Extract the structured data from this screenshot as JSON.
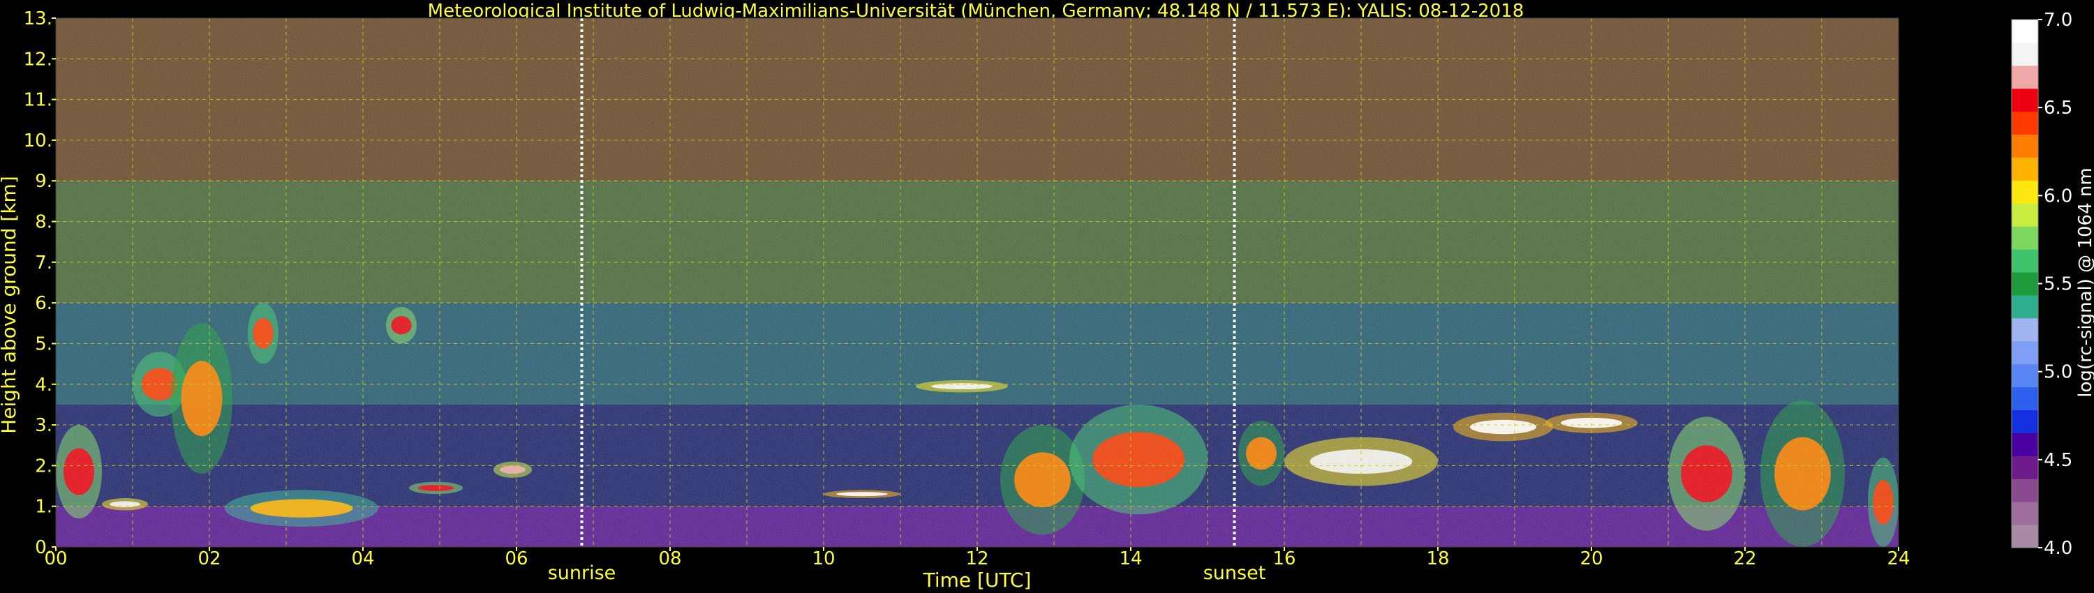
{
  "chart_data": {
    "type": "heatmap",
    "title": "Meteorological Institute of Ludwig-Maximilians-Universität (München, Germany; 48.148 N / 11.573 E):    YALIS: 08-12-2018",
    "xlabel": "Time [UTC]",
    "ylabel": "Height above ground [km]",
    "xlim": [
      0,
      24
    ],
    "ylim": [
      0,
      13
    ],
    "x_ticks": [
      "00",
      "02",
      "04",
      "06",
      "08",
      "10",
      "12",
      "14",
      "16",
      "18",
      "20",
      "22",
      "24"
    ],
    "y_ticks": [
      "0.",
      "1.",
      "2.",
      "3.",
      "4.",
      "5.",
      "6.",
      "7.",
      "8.",
      "9.",
      "10.",
      "11.",
      "12.",
      "13."
    ],
    "grid": true,
    "grid_style": "dashed yellow",
    "colorbar": {
      "label": "log(rc-signal) @ 1064 nm",
      "range": [
        4.0,
        7.0
      ],
      "ticks": [
        "4.0",
        "4.5",
        "5.0",
        "5.5",
        "6.0",
        "6.5",
        "7.0"
      ],
      "colors": [
        "#a98aa6",
        "#9e6e9c",
        "#8a4a8f",
        "#6f1a8a",
        "#4a00a0",
        "#1430e0",
        "#2e60f0",
        "#5a85f5",
        "#7f9ef5",
        "#9fb4f0",
        "#2fae8f",
        "#1e9a3c",
        "#3ec26a",
        "#7ed860",
        "#c8ec40",
        "#ffe812",
        "#ffb300",
        "#ff7e00",
        "#ff3a00",
        "#ee0010",
        "#f0a8a8",
        "#f4f4f4",
        "#ffffff"
      ]
    },
    "annotations": [
      {
        "x": 6.85,
        "label": "sunrise"
      },
      {
        "x": 15.35,
        "label": "sunset"
      }
    ],
    "background_profile": [
      {
        "height_range": [
          0,
          1
        ],
        "level": 4.8,
        "description_color": "#5a1f8f"
      },
      {
        "height_range": [
          1,
          3.5
        ],
        "level": 5.2,
        "description_color": "#232a6b"
      },
      {
        "height_range": [
          3.5,
          6
        ],
        "level": 5.6,
        "description_color": "#2a5e70"
      },
      {
        "height_range": [
          6,
          9
        ],
        "level": 5.8,
        "description_color": "#4c6a3c"
      },
      {
        "height_range": [
          9,
          13
        ],
        "level": 6.0,
        "description_color": "#6a4c2c"
      }
    ],
    "cloud_features": [
      {
        "t0": 0.0,
        "t1": 0.6,
        "z0": 0.7,
        "z1": 3.0,
        "level": 6.5
      },
      {
        "t0": 0.6,
        "t1": 1.2,
        "z0": 0.9,
        "z1": 1.2,
        "level": 6.8
      },
      {
        "t0": 1.0,
        "t1": 1.7,
        "z0": 3.2,
        "z1": 4.8,
        "level": 6.4
      },
      {
        "t0": 1.5,
        "t1": 2.3,
        "z0": 1.8,
        "z1": 5.5,
        "level": 6.3
      },
      {
        "t0": 2.5,
        "t1": 2.9,
        "z0": 4.5,
        "z1": 6.0,
        "level": 6.4
      },
      {
        "t0": 2.2,
        "t1": 4.2,
        "z0": 0.5,
        "z1": 1.4,
        "level": 6.2
      },
      {
        "t0": 4.3,
        "t1": 4.7,
        "z0": 5.0,
        "z1": 5.9,
        "level": 6.5
      },
      {
        "t0": 4.6,
        "t1": 5.3,
        "z0": 1.3,
        "z1": 1.6,
        "level": 6.6
      },
      {
        "t0": 5.7,
        "t1": 6.2,
        "z0": 1.7,
        "z1": 2.1,
        "level": 6.7
      },
      {
        "t0": 10.0,
        "t1": 11.0,
        "z0": 1.2,
        "z1": 1.4,
        "level": 6.9
      },
      {
        "t0": 11.2,
        "t1": 12.4,
        "z0": 3.8,
        "z1": 4.1,
        "level": 6.8
      },
      {
        "t0": 12.3,
        "t1": 13.4,
        "z0": 0.3,
        "z1": 3.0,
        "level": 6.3
      },
      {
        "t0": 13.2,
        "t1": 15.0,
        "z0": 0.8,
        "z1": 3.5,
        "level": 6.4
      },
      {
        "t0": 15.4,
        "t1": 16.0,
        "z0": 1.5,
        "z1": 3.1,
        "level": 6.3
      },
      {
        "t0": 16.0,
        "t1": 18.0,
        "z0": 1.5,
        "z1": 2.7,
        "level": 6.8
      },
      {
        "t0": 18.2,
        "t1": 19.5,
        "z0": 2.6,
        "z1": 3.3,
        "level": 6.9
      },
      {
        "t0": 19.4,
        "t1": 20.6,
        "z0": 2.8,
        "z1": 3.3,
        "level": 6.9
      },
      {
        "t0": 21.0,
        "t1": 22.0,
        "z0": 0.4,
        "z1": 3.2,
        "level": 6.5
      },
      {
        "t0": 22.2,
        "t1": 23.3,
        "z0": 0.0,
        "z1": 3.6,
        "level": 6.3
      },
      {
        "t0": 23.6,
        "t1": 24.0,
        "z0": 0.0,
        "z1": 2.2,
        "level": 6.4
      }
    ]
  }
}
